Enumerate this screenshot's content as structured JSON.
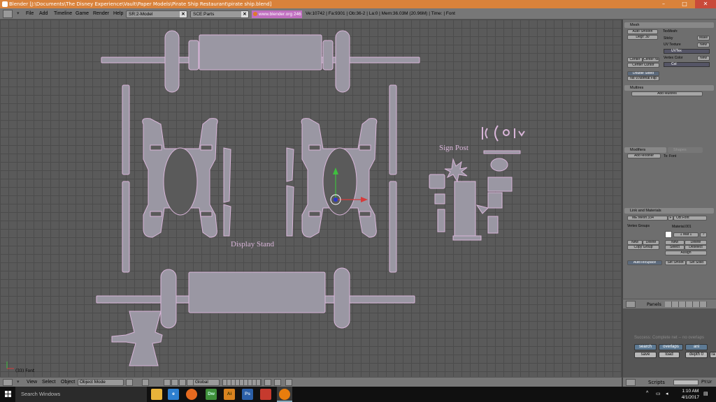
{
  "window": {
    "title": "Blender [J:\\Documents\\The Disney Experience\\Vault\\Paper Models\\Pirate Ship Restaurant\\pirate ship.blend]",
    "controls": [
      "–",
      "□",
      "✕"
    ]
  },
  "menu": {
    "items": [
      "File",
      "Add",
      "Timeline",
      "Game",
      "Render",
      "Help"
    ],
    "screen_field": "SR:2-Model",
    "scene_field": "SCE:Parts",
    "url": "www.blender.org 246",
    "stats": "Ve:10742 | Fa:9301 | Ob:36-2 | La:0  | Mem:36.03M (20.96M) | Time: | Font"
  },
  "viewport": {
    "label_display_stand": "Display Stand",
    "label_sign_post": "Sign Post",
    "object_label": "(33) Font"
  },
  "viewport_header": {
    "menus": [
      "View",
      "Select",
      "Object"
    ],
    "mode": "Object Mode",
    "orientation": "Global"
  },
  "panels": {
    "mesh": {
      "title": "Mesh",
      "auto_smooth": "Auto Smooth",
      "degr": "Degr: 30",
      "texmesh_label": "TexMesh:",
      "sticky": "Sticky",
      "sticky_btn": "Make",
      "uv_texture": "UV Texture",
      "uv_new": "New",
      "uv_value": "UVTex",
      "vertex_color": "Vertex Color",
      "vc_new": "New",
      "vc_value": "Col",
      "center": "Center",
      "center_new": "Center New",
      "center_cursor": "Center Cursor",
      "double_sided": "Double Sided",
      "no_normal_flip": "No V.Normal Flip"
    },
    "multires": {
      "title": "Multires",
      "add": "Add Multires"
    },
    "modifiers": {
      "title": "Modifiers",
      "tab2": "Shapes",
      "add": "Add Modifier",
      "to": "To: Font"
    },
    "link": {
      "title": "Link and Materials",
      "me": "ME:Mesh.334",
      "f": "F",
      "ob": "OB:Font",
      "vertex_groups": "Vertex Groups",
      "material": "Material.001",
      "mat_slot": "1 Mat 1",
      "mat_q": "?",
      "new": "New",
      "delete": "Delete",
      "copy_group": "Copy Group",
      "new2": "New",
      "delete2": "Delete",
      "select": "Select",
      "deselect": "Deselect",
      "assign": "Assign",
      "autotex": "AutoTexSpace",
      "set_smooth": "Set Smoot",
      "set_solid": "Set Solid"
    }
  },
  "panels_header": {
    "label": "Panels"
  },
  "script": {
    "message": "Success: Complete net -- no overlaps",
    "search": "search",
    "overlaps": "overlaps",
    "ani": "ani",
    "save": "save",
    "load": "load",
    "depth": "depth 0",
    "ra": "ra"
  },
  "scripts_header": {
    "label": "Scripts",
    "pyur": "PY:Ur"
  },
  "taskbar": {
    "search_placeholder": "Search Windows",
    "time": "1:10 AM",
    "date": "4/1/2017",
    "apps": [
      {
        "name": "file-explorer-icon",
        "label": "",
        "color": "#e8b33a"
      },
      {
        "name": "edge-icon",
        "label": "e",
        "color": "#2d7fd0"
      },
      {
        "name": "firefox-icon",
        "label": "",
        "color": "#e66a1f"
      },
      {
        "name": "dreamweaver-icon",
        "label": "Dw",
        "color": "#3f8f3a"
      },
      {
        "name": "illustrator-icon",
        "label": "Ai",
        "color": "#d9831f"
      },
      {
        "name": "photoshop-icon",
        "label": "Ps",
        "color": "#2b5fa8"
      },
      {
        "name": "acrobat-icon",
        "label": "",
        "color": "#c63a2e"
      },
      {
        "name": "blender-icon",
        "label": "",
        "color": "#e87d0d"
      }
    ]
  },
  "colors": {
    "part_fill": "#9a97a3",
    "part_stroke": "#d9b5d9",
    "accent": "#d9823b"
  }
}
